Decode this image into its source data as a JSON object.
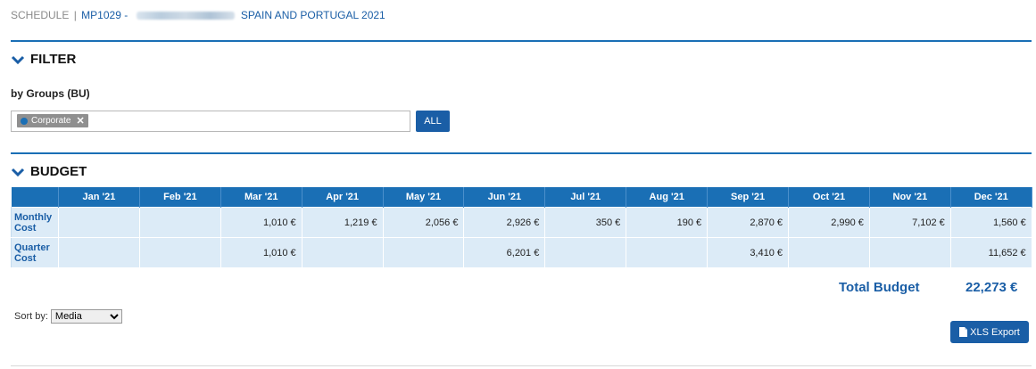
{
  "breadcrumb": {
    "section": "SCHEDULE",
    "separator": "|",
    "code": "MP1029 -",
    "title": "SPAIN AND PORTUGAL 2021"
  },
  "filter": {
    "heading": "FILTER",
    "group_label": "by Groups (BU)",
    "tag_label": "Corporate",
    "tag_remove": "✕",
    "all_button": "ALL"
  },
  "budget": {
    "heading": "BUDGET",
    "months": [
      "Jan '21",
      "Feb '21",
      "Mar '21",
      "Apr '21",
      "May '21",
      "Jun '21",
      "Jul '21",
      "Aug '21",
      "Sep '21",
      "Oct '21",
      "Nov '21",
      "Dec '21"
    ],
    "rows": [
      {
        "label": "Monthly Cost",
        "values": [
          "",
          "",
          "1,010 €",
          "1,219 €",
          "2,056 €",
          "2,926 €",
          "350 €",
          "190 €",
          "2,870 €",
          "2,990 €",
          "7,102 €",
          "1,560 €"
        ]
      },
      {
        "label": "Quarter Cost",
        "values": [
          "",
          "",
          "1,010 €",
          "",
          "",
          "6,201 €",
          "",
          "",
          "3,410 €",
          "",
          "",
          "11,652 €"
        ]
      }
    ],
    "total_label": "Total Budget",
    "total_value": "22,273 €"
  },
  "sort": {
    "label": "Sort by:",
    "selected": "Media"
  },
  "export": {
    "label": "XLS Export"
  },
  "colors": {
    "accent": "#1a6fb5",
    "link": "#1a5ea6",
    "cell_bg": "#dcebf7"
  }
}
